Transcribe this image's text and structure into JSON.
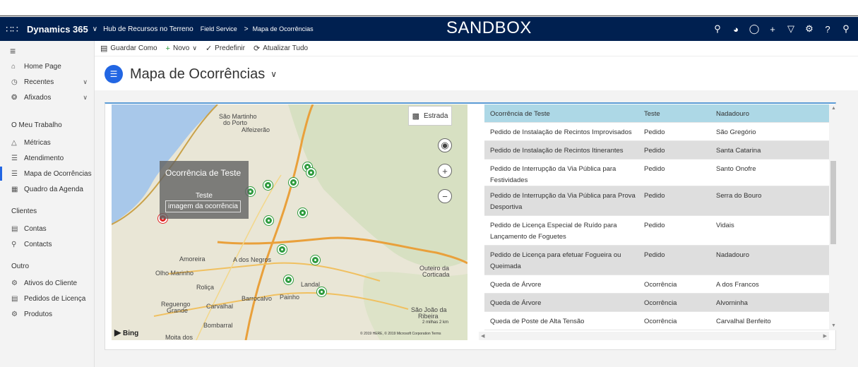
{
  "navbar": {
    "app_name": "Dynamics 365",
    "hub": "Hub de Recursos no Terreno",
    "crumb_area": "Field Service",
    "crumb_sep": ">",
    "crumb_page": "Mapa de Ocorrências",
    "sandbox": "SANDBOX"
  },
  "sidebar": {
    "home": "Home Page",
    "recent": "Recentes",
    "pinned": "Afixados",
    "section_work": "O Meu Trabalho",
    "metrics": "Métricas",
    "service": "Atendimento",
    "incident_map": "Mapa de Ocorrências",
    "schedule_board": "Quadro da Agenda",
    "section_clients": "Clientes",
    "accounts": "Contas",
    "contacts": "Contacts",
    "section_other": "Outro",
    "assets": "Ativos do Cliente",
    "license_requests": "Pedidos de Licença",
    "products": "Produtos"
  },
  "commands": {
    "save_as": "Guardar Como",
    "new": "Novo",
    "set_default": "Predefinir",
    "refresh_all": "Atualizar Tudo"
  },
  "page": {
    "title": "Mapa de Ocorrências"
  },
  "map": {
    "style_button": "Estrada",
    "places": {
      "sao_martinho": "São Martinho",
      "do_porto": "do Porto",
      "alfeizerao": "Alfeizerão",
      "amoreira": "Amoreira",
      "a_dos_negros": "A dos Negros",
      "olho_marinho": "Olho Marinho",
      "rolica": "Roliça",
      "barrocalvo": "Barrocalvo",
      "painho": "Painho",
      "landal": "Landal",
      "outeiro": "Outeiro da",
      "corticada": "Corticada",
      "reguengo": "Reguengo",
      "grande": "Grande",
      "carvalhal": "Carvalhal",
      "sao_joao": "São João da",
      "ribeira": "Ribeira",
      "bombarral": "Bombarral",
      "moita_dos": "Moita dos"
    },
    "popup": {
      "title": "Ocorrência de Teste",
      "subtitle": "Teste",
      "link": "imagem da ocorrência"
    },
    "bing": "Bing",
    "scale": "2 milhas    2 km",
    "copyright": "© 2019 HERE, © 2019 Microsoft Corporation  Terms"
  },
  "table": {
    "rows": [
      {
        "name": "Ocorrência de Teste",
        "type": "Teste",
        "place": "Nadadouro"
      },
      {
        "name": "Pedido de Instalação de Recintos Improvisados",
        "type": "Pedido",
        "place": "São Gregório"
      },
      {
        "name": "Pedido de Instalação de Recintos Itinerantes",
        "type": "Pedido",
        "place": "Santa Catarina"
      },
      {
        "name": "Pedido de Interrupção da Via Pública para Festividades",
        "type": "Pedido",
        "place": "Santo Onofre"
      },
      {
        "name": "Pedido de Interrupção da Via Pública para Prova Desportiva",
        "type": "Pedido",
        "place": "Serra do Bouro"
      },
      {
        "name": "Pedido de Licença Especial de Ruído para Lançamento de Foguetes",
        "type": "Pedido",
        "place": "Vidais"
      },
      {
        "name": "Pedido de Licença para efetuar Fogueira ou Queimada",
        "type": "Pedido",
        "place": "Nadadouro"
      },
      {
        "name": "Queda de Árvore",
        "type": "Ocorrência",
        "place": "A dos Francos"
      },
      {
        "name": "Queda de Árvore",
        "type": "Ocorrência",
        "place": "Alvorninha"
      },
      {
        "name": "Queda de Poste de Alta Tensão",
        "type": "Ocorrência",
        "place": "Carvalhal Benfeito"
      }
    ]
  },
  "colors": {
    "navbar": "#002050",
    "accent": "#2266e3",
    "pin_green": "#2e9b3e",
    "pin_red": "#e02424",
    "selected_row": "#add8e6"
  }
}
